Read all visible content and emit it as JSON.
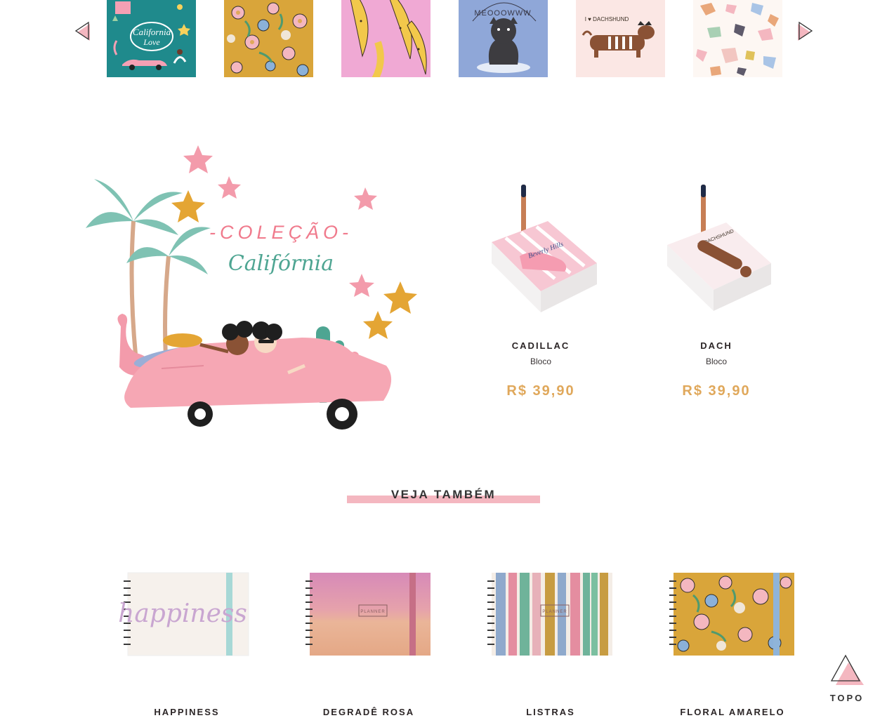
{
  "carousel": {
    "prev_icon": "triangle-left-icon",
    "next_icon": "triangle-right-icon",
    "thumbs": [
      {
        "name": "california-love"
      },
      {
        "name": "floral-amarelo"
      },
      {
        "name": "bananas"
      },
      {
        "name": "meow-cat"
      },
      {
        "name": "dachshund"
      },
      {
        "name": "terrazzo"
      }
    ]
  },
  "collection": {
    "title_line1": "-COLEÇÃO-",
    "title_line2": "Califórnia",
    "products": [
      {
        "name": "CADILLAC",
        "type": "Bloco",
        "price": "R$ 39,90",
        "cover_text": "Beverly Hills"
      },
      {
        "name": "DACH",
        "type": "Bloco",
        "price": "R$ 39,90",
        "cover_text": "I ♥ DACHSHUND"
      }
    ]
  },
  "see_also": {
    "title": "VEJA TAMBÉM",
    "items": [
      {
        "name": "HAPPINESS",
        "cover_text": "happiness"
      },
      {
        "name": "DEGRADÊ ROSA",
        "cover_text": "PLANNER"
      },
      {
        "name": "LISTRAS",
        "cover_text": "PLANNER"
      },
      {
        "name": "FLORAL AMARELO",
        "cover_text": ""
      }
    ]
  },
  "back_to_top": {
    "label": "TOPO"
  },
  "colors": {
    "accent_pink": "#f4b7c0",
    "price_gold": "#e0a85b",
    "text_dark": "#2b2526"
  }
}
